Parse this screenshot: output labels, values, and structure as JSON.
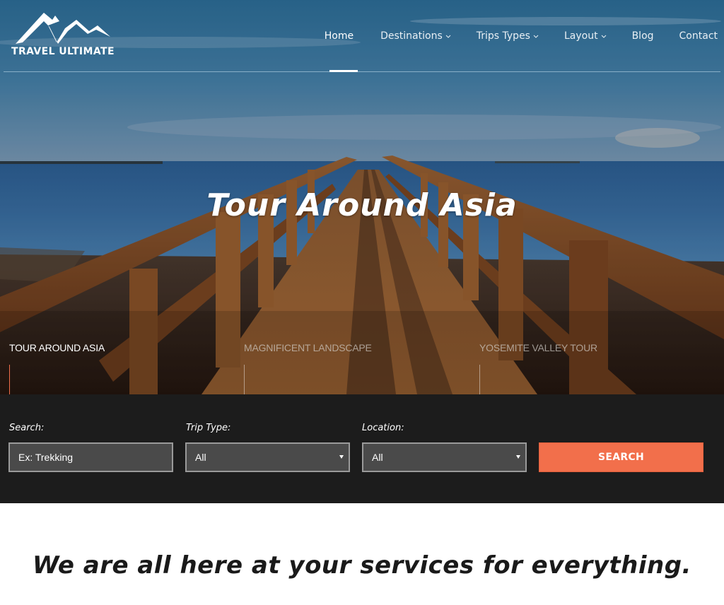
{
  "brand": {
    "name": "TRAVEL ULTIMATE",
    "logo_icon": "mountain-icon"
  },
  "nav": {
    "items": [
      {
        "label": "Home",
        "active": true,
        "dropdown": false
      },
      {
        "label": "Destinations",
        "active": false,
        "dropdown": true
      },
      {
        "label": "Trips Types",
        "active": false,
        "dropdown": true
      },
      {
        "label": "Layout",
        "active": false,
        "dropdown": true
      },
      {
        "label": "Blog",
        "active": false,
        "dropdown": false
      },
      {
        "label": "Contact",
        "active": false,
        "dropdown": false
      }
    ],
    "dropdown_icon": "chevron-down-icon"
  },
  "hero": {
    "title": "Tour Around Asia",
    "slides": [
      {
        "label": "TOUR AROUND ASIA",
        "active": true
      },
      {
        "label": "MAGNIFICENT LANDSCAPE",
        "active": false
      },
      {
        "label": "YOSEMITE VALLEY TOUR",
        "active": false
      }
    ]
  },
  "search": {
    "search_label": "Search:",
    "search_placeholder": "Ex: Trekking",
    "trip_type_label": "Trip Type:",
    "trip_type_value": "All",
    "location_label": "Location:",
    "location_value": "All",
    "button_label": "SEARCH"
  },
  "tagline": "We are all here at your services for everything.",
  "colors": {
    "accent": "#f26f4b",
    "search_panel_bg": "#1c1c1c",
    "field_bg": "#4a4a4a"
  }
}
